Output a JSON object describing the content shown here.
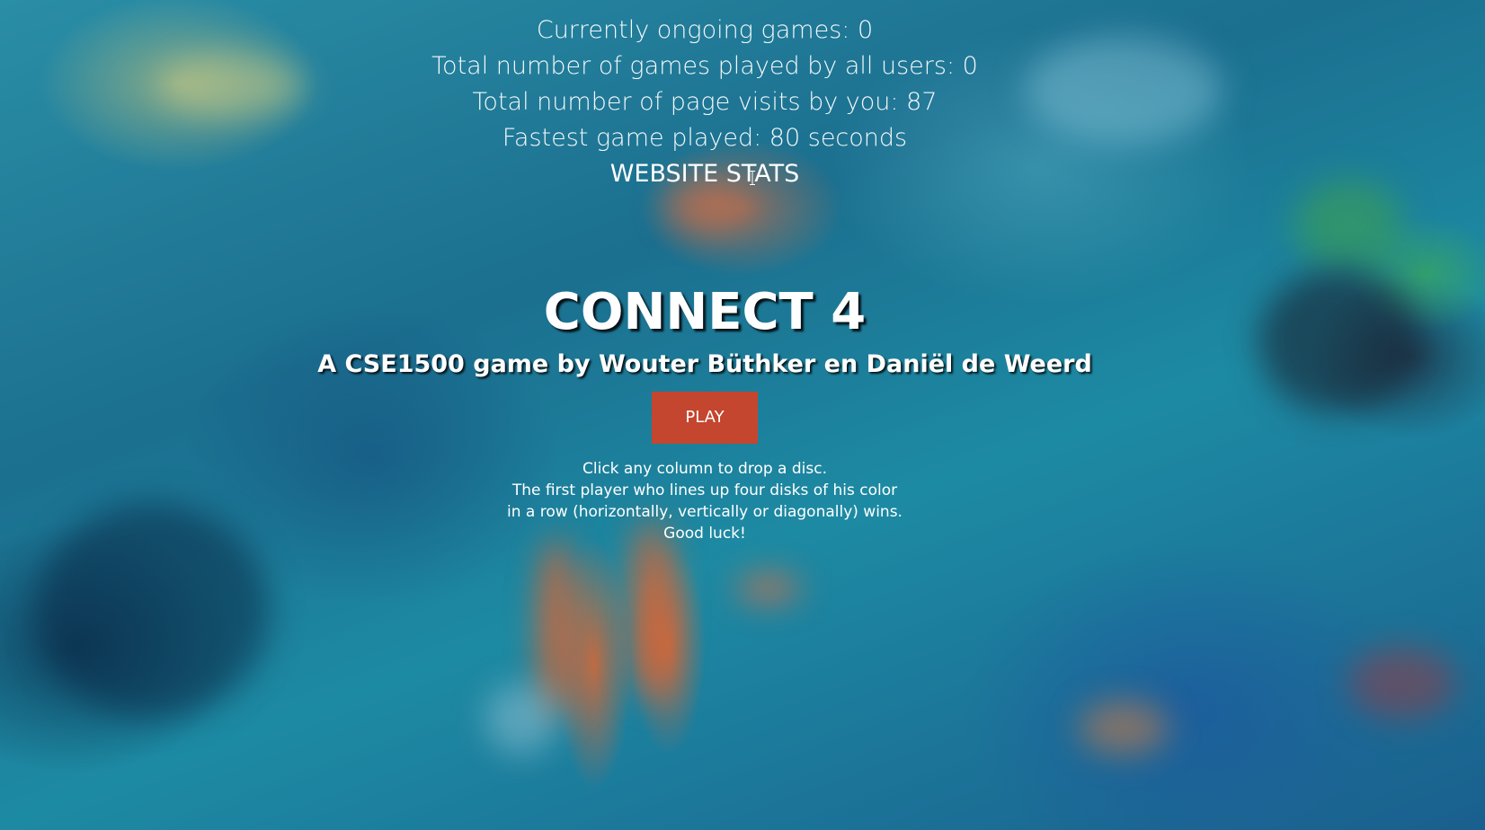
{
  "stats": {
    "ongoing_games": "Currently ongoing games: 0",
    "total_games": "Total number of games played by all users: 0",
    "page_visits": "Total number of page visits by you: 87",
    "fastest_game": "Fastest game played: 80 seconds",
    "title": "WEBSITE STATS"
  },
  "hero": {
    "title": "CONNECT 4",
    "subtitle": "A CSE1500 game by Wouter Büthker en Daniël de Weerd",
    "play_label": "PLAY"
  },
  "instructions": {
    "lines": [
      "Click any column to drop a disc.",
      "The first player who lines up four disks of his color",
      "in a row (horizontally, vertically or diagonally) wins.",
      "Good luck!"
    ]
  },
  "colors": {
    "play_button": "#c4462f",
    "background_primary": "#1d8aa3",
    "text": "#ffffff"
  },
  "icons": {
    "cursor": "text-cursor-icon"
  }
}
